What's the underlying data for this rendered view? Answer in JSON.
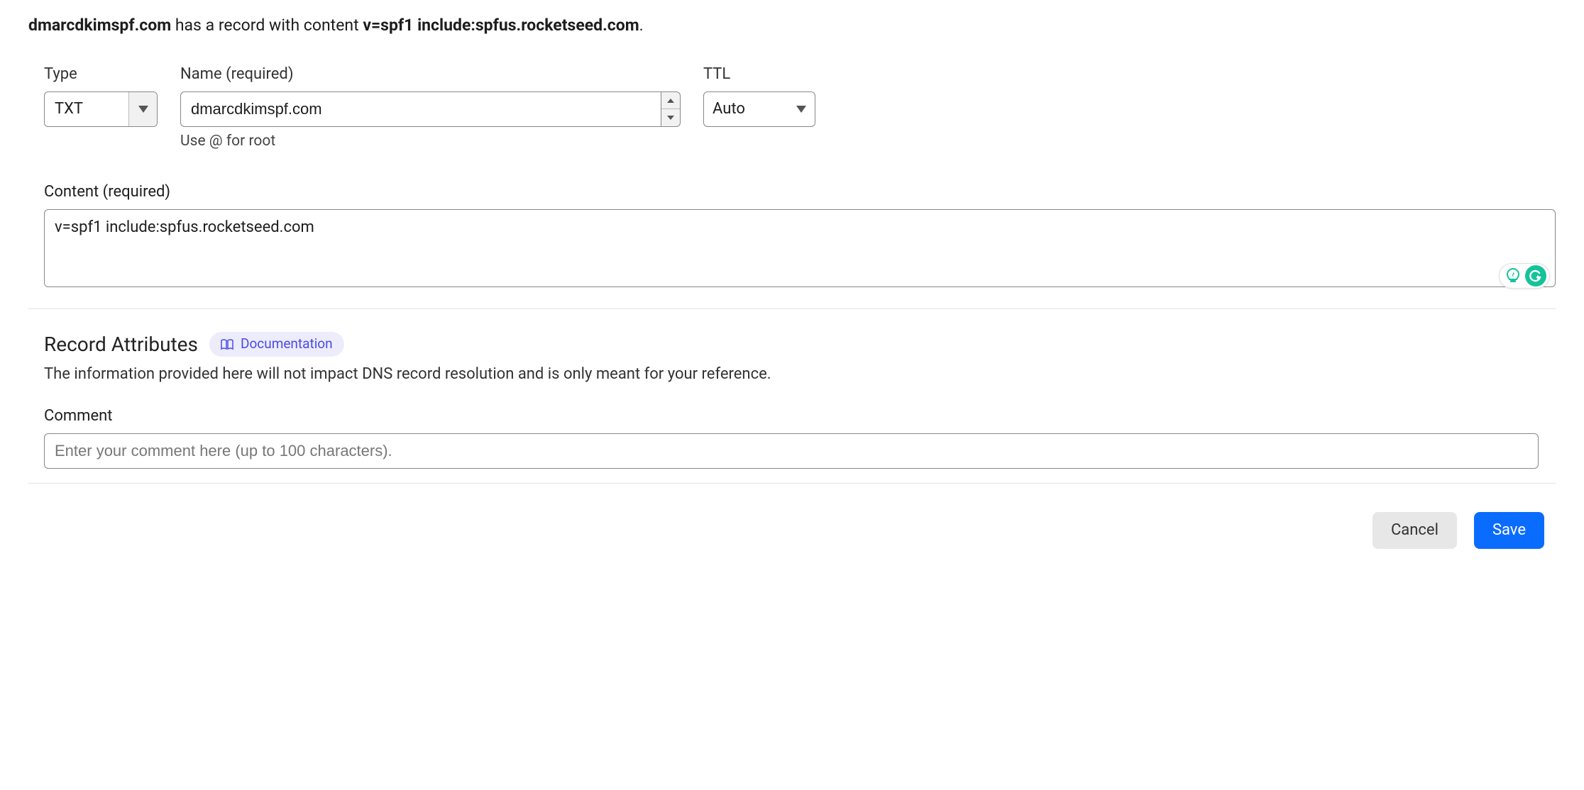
{
  "header": {
    "domain": "dmarcdkimspf.com",
    "middle_text": " has a record with content ",
    "record_content": "v=spf1 include:spfus.rocketseed.com",
    "suffix": "."
  },
  "typeField": {
    "label": "Type",
    "value": "TXT"
  },
  "nameField": {
    "label": "Name (required)",
    "value": "dmarcdkimspf.com",
    "helper": "Use @ for root"
  },
  "ttlField": {
    "label": "TTL",
    "value": "Auto"
  },
  "contentField": {
    "label": "Content (required)",
    "value": "v=spf1 include:spfus.rocketseed.com"
  },
  "attributes": {
    "title": "Record Attributes",
    "doc_label": "Documentation",
    "description": "The information provided here will not impact DNS record resolution and is only meant for your reference."
  },
  "commentField": {
    "label": "Comment",
    "placeholder": "Enter your comment here (up to 100 characters)."
  },
  "buttons": {
    "cancel": "Cancel",
    "save": "Save"
  }
}
